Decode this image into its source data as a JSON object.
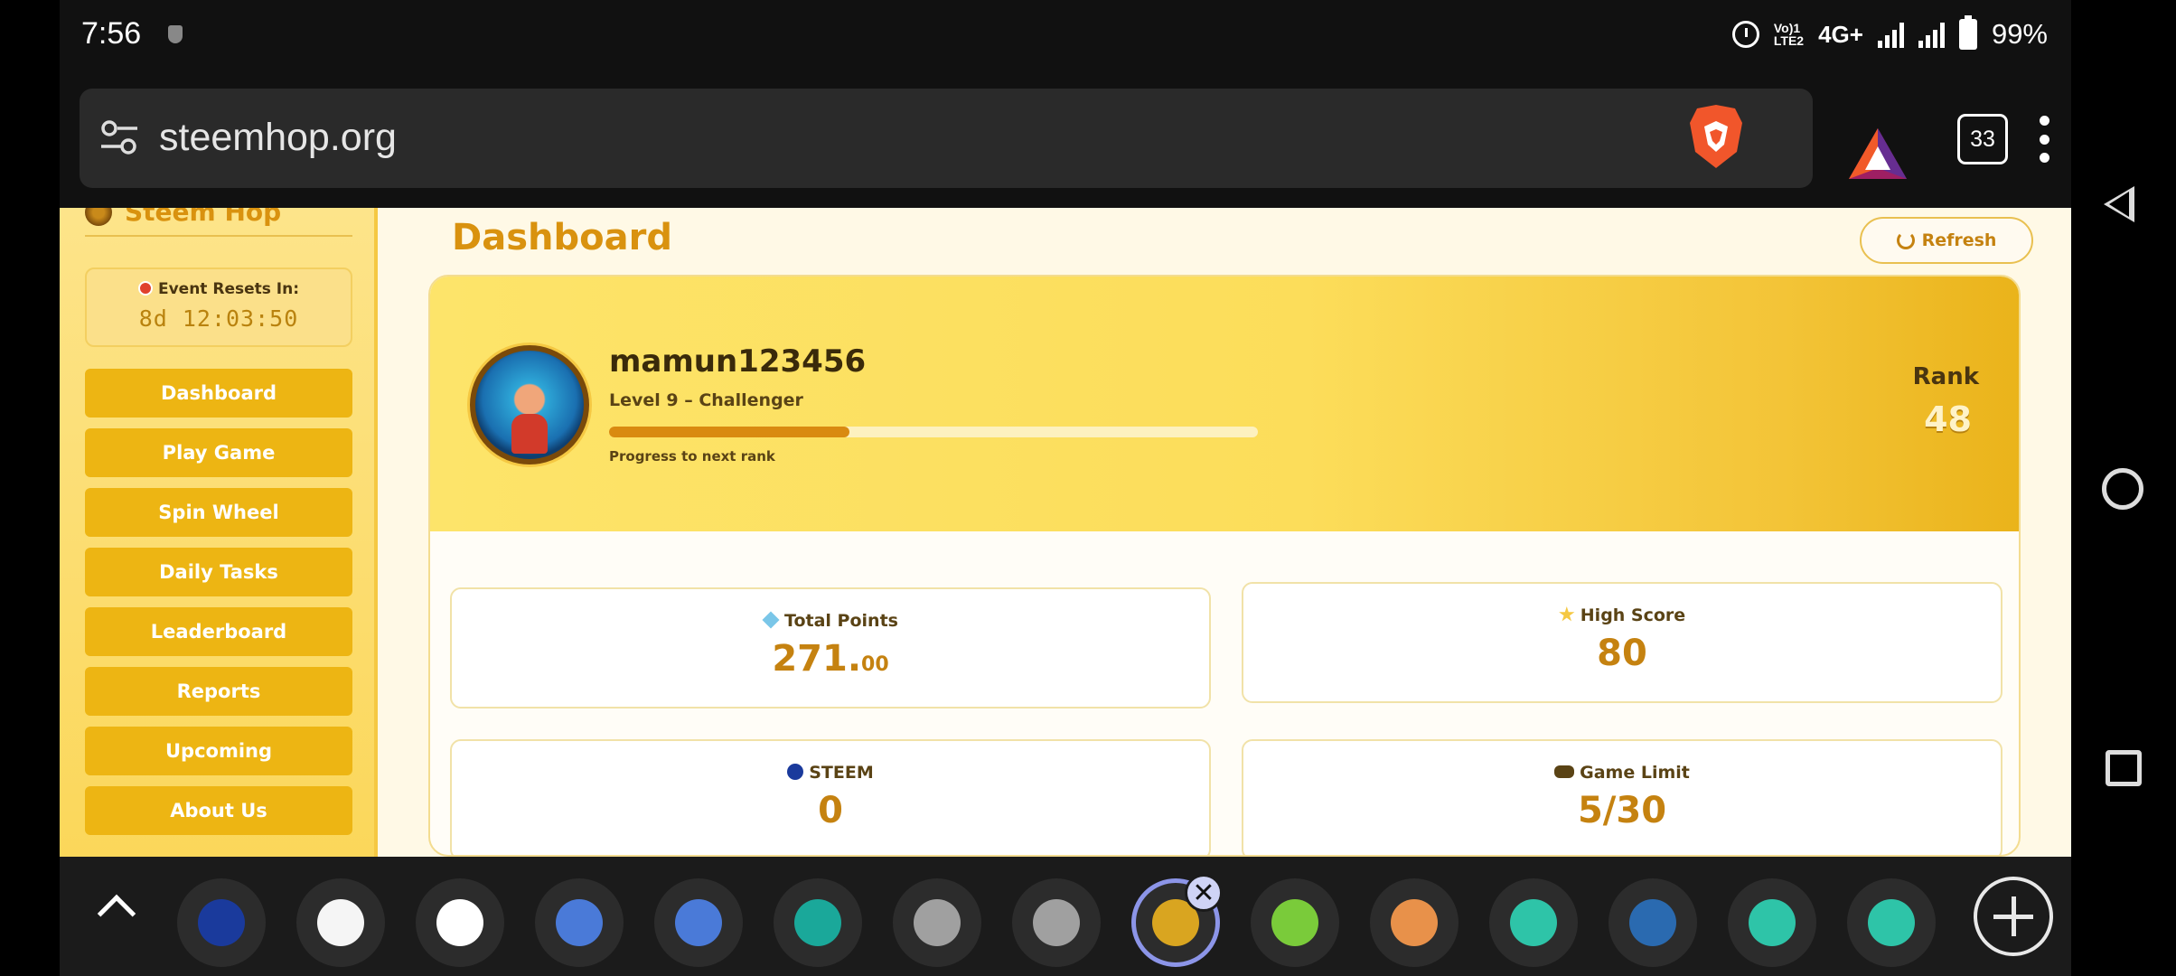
{
  "status_bar": {
    "time": "7:56",
    "volte": "Vo) 1\nLTE2",
    "network": "4G+",
    "battery_percent": "99%"
  },
  "browser": {
    "url": "steemhop.org",
    "tab_count": "33"
  },
  "sidebar": {
    "brand": "Steem Hop",
    "event_label": "Event Resets In:",
    "event_timer": "8d 12:03:50",
    "nav": [
      {
        "label": "Dashboard"
      },
      {
        "label": "Play Game"
      },
      {
        "label": "Spin Wheel"
      },
      {
        "label": "Daily Tasks"
      },
      {
        "label": "Leaderboard"
      },
      {
        "label": "Reports"
      },
      {
        "label": "Upcoming"
      },
      {
        "label": "About Us"
      }
    ]
  },
  "main": {
    "title": "Dashboard",
    "refresh_label": "Refresh",
    "profile": {
      "username": "mamun123456",
      "level": "Level 9 – Challenger",
      "progress_label": "Progress to next rank",
      "progress_fraction": 0.37,
      "rank_label": "Rank",
      "rank_value": "48"
    },
    "stats": {
      "total_points": {
        "label": "Total Points",
        "value_int": "271.",
        "value_dec": "00"
      },
      "high_score": {
        "label": "High Score",
        "value": "80"
      },
      "steem": {
        "label": "STEEM",
        "value": "0"
      },
      "game_limit": {
        "label": "Game Limit",
        "value": "5/30"
      }
    }
  },
  "tab_strip": {
    "icons": [
      "steem-tab-icon",
      "white-dot-tab-icon",
      "google-tab-icon",
      "p-tab-icon",
      "p-tab-icon",
      "a4-tab-icon",
      "globe-tab-icon",
      "globe-tab-icon",
      "steemhop-tab-icon",
      "parrot-tab-icon",
      "orange-tab-icon",
      "teal-tab-icon",
      "blue-tab-icon",
      "teal-tab-icon",
      "teal-tab-icon"
    ],
    "active_index": 8
  },
  "colors": {
    "accent": "#edb513",
    "title": "#d9920f",
    "progress": "#d98a10"
  }
}
